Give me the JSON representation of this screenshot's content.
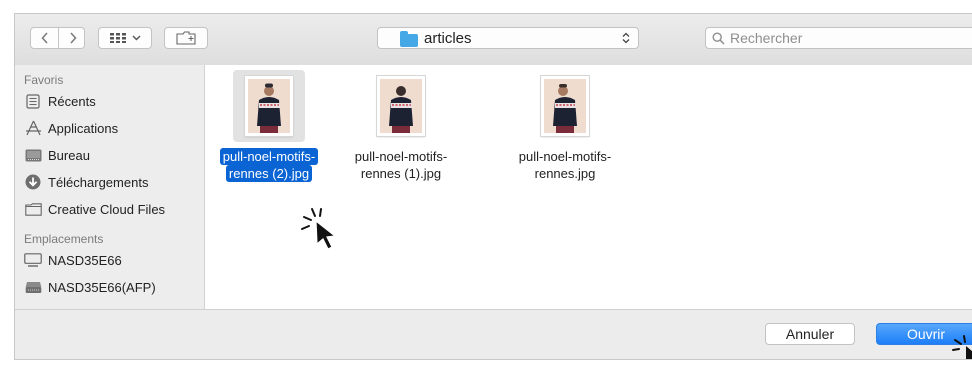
{
  "toolbar": {
    "back_icon": "chevron-left-icon",
    "forward_icon": "chevron-right-icon",
    "view_icon": "grid-view-icon",
    "new_folder_icon": "new-folder-icon",
    "location": "articles",
    "search_placeholder": "Rechercher"
  },
  "sidebar": {
    "favorites_heading": "Favoris",
    "favorites": [
      {
        "label": "Récents",
        "icon": "recents-icon"
      },
      {
        "label": "Applications",
        "icon": "applications-icon"
      },
      {
        "label": "Bureau",
        "icon": "desktop-icon"
      },
      {
        "label": "Téléchargements",
        "icon": "downloads-icon"
      },
      {
        "label": "Creative Cloud Files",
        "icon": "folder-icon"
      }
    ],
    "locations_heading": "Emplacements",
    "locations": [
      {
        "label": "NASD35E66",
        "icon": "display-icon"
      },
      {
        "label": "NASD35E66(AFP)",
        "icon": "network-drive-icon"
      }
    ]
  },
  "files": [
    {
      "line1": "pull-noel-motifs-",
      "line2": "rennes (2).jpg",
      "selected": true
    },
    {
      "line1": "pull-noel-motifs-",
      "line2": "rennes (1).jpg",
      "selected": false
    },
    {
      "line1": "pull-noel-motifs-",
      "line2": "rennes.jpg",
      "selected": false
    }
  ],
  "buttons": {
    "cancel": "Annuler",
    "open": "Ouvrir"
  },
  "colors": {
    "selection": "#0b64d3",
    "primary_button": "#1d7ef8",
    "folder": "#45a8e6"
  }
}
